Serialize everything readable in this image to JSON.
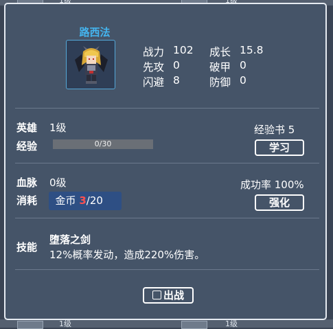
{
  "background_list": {
    "top_level_1": "1级",
    "top_level_2": "1级",
    "bottom_level_1": "1级",
    "bottom_level_2": "1级"
  },
  "hero": {
    "name": "路西法",
    "stats": [
      {
        "label": "战力",
        "value": "102"
      },
      {
        "label": "成长",
        "value": "15.8"
      },
      {
        "label": "先攻",
        "value": "0"
      },
      {
        "label": "破甲",
        "value": "0"
      },
      {
        "label": "闪避",
        "value": "8"
      },
      {
        "label": "防御",
        "value": "0"
      }
    ]
  },
  "level_section": {
    "hero_label": "英雄",
    "hero_level": "1级",
    "exp_label": "经验",
    "exp_progress": "0/30",
    "exp_fraction": 0,
    "book_label": "经验书 5",
    "learn_button": "学习"
  },
  "bloodline_section": {
    "bloodline_label": "血脉",
    "bloodline_level": "0级",
    "cost_label": "消耗",
    "coin_label": "金币 ",
    "coin_have": "3",
    "coin_need": "/20",
    "success_rate": "成功率 100%",
    "enhance_button": "强化"
  },
  "skill_section": {
    "skill_label": "技能",
    "skill_name": "堕落之剑",
    "skill_desc": "12%概率发动，造成220%伤害。"
  },
  "deploy_button": "出战",
  "colors": {
    "panel_bg": "#455468",
    "name_blue": "#44b4ee",
    "coin_red": "#ff5050",
    "coin_box": "#2e4f84"
  }
}
